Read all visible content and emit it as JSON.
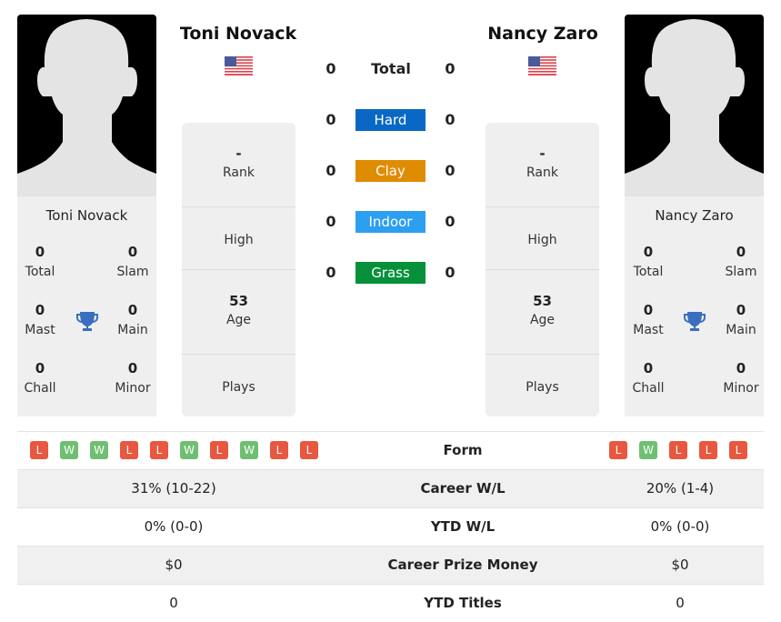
{
  "players": {
    "left": {
      "name": "Toni Novack",
      "country_flag": "us-flag-icon",
      "titles": {
        "total": {
          "value": "0",
          "label": "Total"
        },
        "slam": {
          "value": "0",
          "label": "Slam"
        },
        "mast": {
          "value": "0",
          "label": "Mast"
        },
        "main": {
          "value": "0",
          "label": "Main"
        },
        "chall": {
          "value": "0",
          "label": "Chall"
        },
        "minor": {
          "value": "0",
          "label": "Minor"
        }
      },
      "info": {
        "rank": {
          "value": "-",
          "label": "Rank"
        },
        "high": {
          "value": "",
          "label": "High"
        },
        "age": {
          "value": "53",
          "label": "Age"
        },
        "plays": {
          "value": "",
          "label": "Plays"
        }
      },
      "form": [
        "L",
        "W",
        "W",
        "L",
        "L",
        "W",
        "L",
        "W",
        "L",
        "L"
      ]
    },
    "right": {
      "name": "Nancy Zaro",
      "country_flag": "us-flag-icon",
      "titles": {
        "total": {
          "value": "0",
          "label": "Total"
        },
        "slam": {
          "value": "0",
          "label": "Slam"
        },
        "mast": {
          "value": "0",
          "label": "Mast"
        },
        "main": {
          "value": "0",
          "label": "Main"
        },
        "chall": {
          "value": "0",
          "label": "Chall"
        },
        "minor": {
          "value": "0",
          "label": "Minor"
        }
      },
      "info": {
        "rank": {
          "value": "-",
          "label": "Rank"
        },
        "high": {
          "value": "",
          "label": "High"
        },
        "age": {
          "value": "53",
          "label": "Age"
        },
        "plays": {
          "value": "",
          "label": "Plays"
        }
      },
      "form": [
        "L",
        "W",
        "L",
        "L",
        "L"
      ]
    }
  },
  "h2h": {
    "total": {
      "label": "Total",
      "left": "0",
      "right": "0"
    },
    "surfaces": [
      {
        "label": "Hard",
        "left": "0",
        "right": "0",
        "color": "#0868c4"
      },
      {
        "label": "Clay",
        "left": "0",
        "right": "0",
        "color": "#df8c00"
      },
      {
        "label": "Indoor",
        "left": "0",
        "right": "0",
        "color": "#2d9ff0"
      },
      {
        "label": "Grass",
        "left": "0",
        "right": "0",
        "color": "#07903a"
      }
    ]
  },
  "comparison": {
    "form_label": "Form",
    "rows": [
      {
        "label": "Career W/L",
        "left": "31% (10-22)",
        "right": "20% (1-4)"
      },
      {
        "label": "YTD W/L",
        "left": "0% (0-0)",
        "right": "0% (0-0)"
      },
      {
        "label": "Career Prize Money",
        "left": "$0",
        "right": "$0"
      },
      {
        "label": "YTD Titles",
        "left": "0",
        "right": "0"
      }
    ]
  },
  "colors": {
    "loss": "#e8573f",
    "win": "#6fbf73",
    "trophy": "#3a6fbf"
  }
}
